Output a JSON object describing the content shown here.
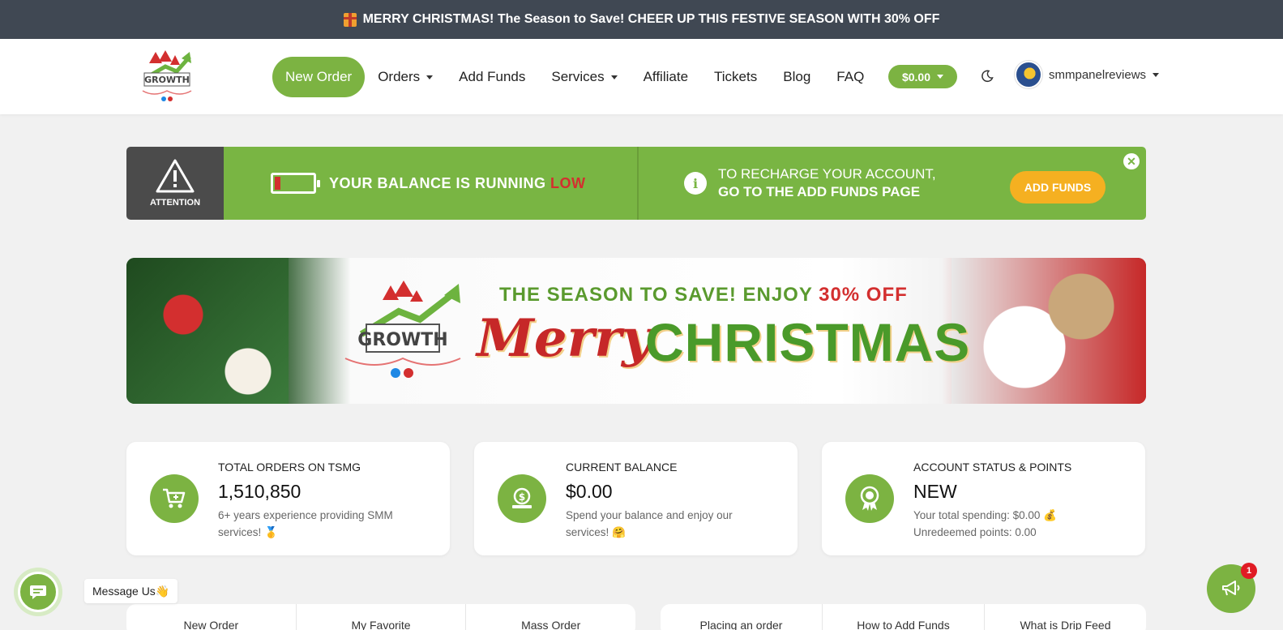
{
  "promo": {
    "text": "MERRY CHRISTMAS! The Season to Save! CHEER UP THIS FESTIVE SEASON WITH 30% OFF",
    "icon": "gift-icon"
  },
  "nav": {
    "logo_alt": "Social Media Growth",
    "new_order": "New Order",
    "orders": "Orders",
    "add_funds": "Add Funds",
    "services": "Services",
    "affiliate": "Affiliate",
    "tickets": "Tickets",
    "blog": "Blog",
    "faq": "FAQ",
    "balance": "$0.00",
    "username": "smmpanelreviews"
  },
  "attention": {
    "label": "ATTENTION",
    "balance_msg": "YOUR BALANCE IS RUNNING",
    "balance_low": "LOW",
    "recharge_l1": "TO RECHARGE YOUR ACCOUNT,",
    "recharge_l2": "GO TO THE ADD FUNDS PAGE",
    "button": "ADD FUNDS",
    "battery_level": 0.15
  },
  "xmas_banner": {
    "tagline_a": "THE SEASON TO SAVE! ENJOY",
    "tagline_pct": "30% OFF",
    "merry": "Merry",
    "christmas": "CHRISTMAS"
  },
  "cards": [
    {
      "label": "TOTAL ORDERS ON TSMG",
      "value": "1,510,850",
      "desc1": "6+ years experience providing SMM",
      "desc2": "services! 🥇",
      "icon": "cart-icon"
    },
    {
      "label": "CURRENT BALANCE",
      "value": "$0.00",
      "desc1": "Spend your balance and enjoy our",
      "desc2": "services! 🤗",
      "icon": "money-icon"
    },
    {
      "label": "ACCOUNT STATUS & POINTS",
      "value": "NEW",
      "desc1": "Your total spending: $0.00 💰",
      "desc2": "Unredeemed points: 0.00",
      "icon": "award-icon"
    }
  ],
  "tabs_left": [
    "New Order",
    "My Favorite",
    "Mass Order"
  ],
  "tabs_right": [
    "Placing an order",
    "How to Add Funds",
    "What is Drip Feed"
  ],
  "chat": {
    "label": "Message Us👋"
  },
  "announce": {
    "badge": "1"
  },
  "colors": {
    "brand_green": "#7cb342",
    "promo_bg": "#404853",
    "accent_orange": "#f5b021",
    "low_red": "#d32f2f"
  }
}
